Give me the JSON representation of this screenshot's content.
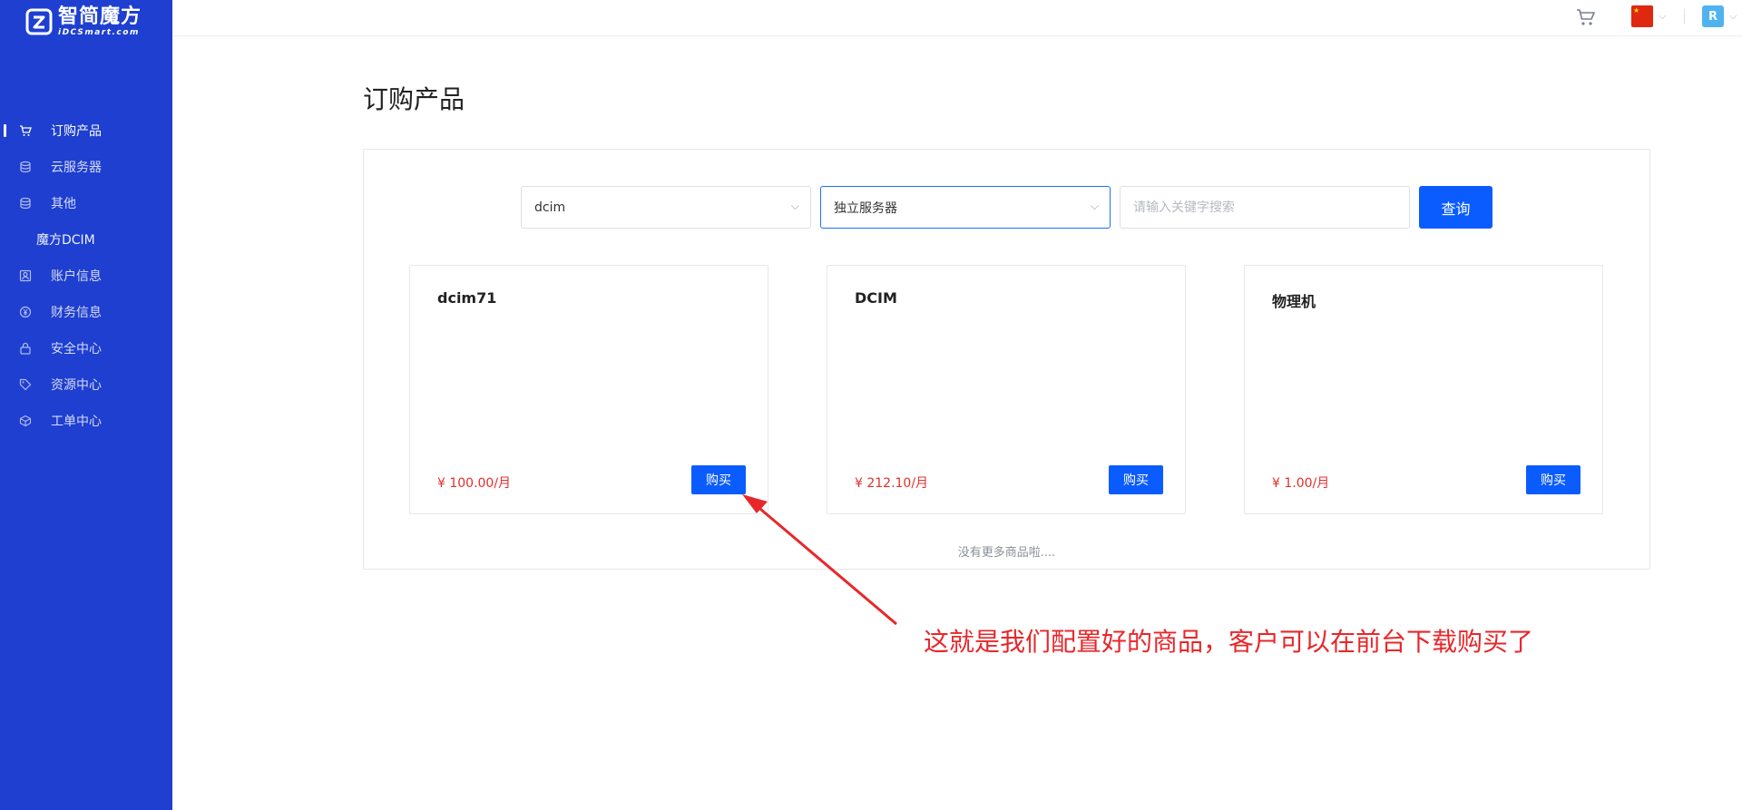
{
  "brand": {
    "name_cn": "智简魔方",
    "name_en": "iDCSmart.com"
  },
  "sidebar": {
    "items": [
      {
        "label": "订购产品",
        "icon": "cart-icon",
        "active": true
      },
      {
        "label": "云服务器",
        "icon": "database-icon"
      },
      {
        "label": "其他",
        "icon": "database-icon"
      },
      {
        "label": "魔方DCIM",
        "icon": "",
        "sub": true
      },
      {
        "label": "账户信息",
        "icon": "user-card-icon"
      },
      {
        "label": "财务信息",
        "icon": "yen-circle-icon"
      },
      {
        "label": "安全中心",
        "icon": "lock-icon"
      },
      {
        "label": "资源中心",
        "icon": "tag-icon"
      },
      {
        "label": "工单中心",
        "icon": "box-icon"
      }
    ]
  },
  "topbar": {
    "avatar_letter": "R",
    "icons": [
      "cart-icon",
      "china-flag-icon",
      "chevron-down-icon",
      "avatar",
      "chevron-down-icon"
    ]
  },
  "main": {
    "title": "订购产品",
    "filters": {
      "group_select": "dcim",
      "type_select": "独立服务器",
      "search_placeholder": "请输入关键字搜索",
      "query_label": "查询"
    },
    "products": [
      {
        "name": "dcim71",
        "price": "¥  100.00/月",
        "buy_label": "购买"
      },
      {
        "name": "DCIM",
        "price": "¥  212.10/月",
        "buy_label": "购买"
      },
      {
        "name": "物理机",
        "price": "¥  1.00/月",
        "buy_label": "购买"
      }
    ],
    "no_more": "没有更多商品啦...."
  },
  "annotation": {
    "text": "这就是我们配置好的商品，客户可以在前台下载购买了"
  },
  "colors": {
    "sidebar_bg": "#1e3fcf",
    "primary": "#0b5cff",
    "price": "#e0302b",
    "annotation": "#e8272b"
  }
}
